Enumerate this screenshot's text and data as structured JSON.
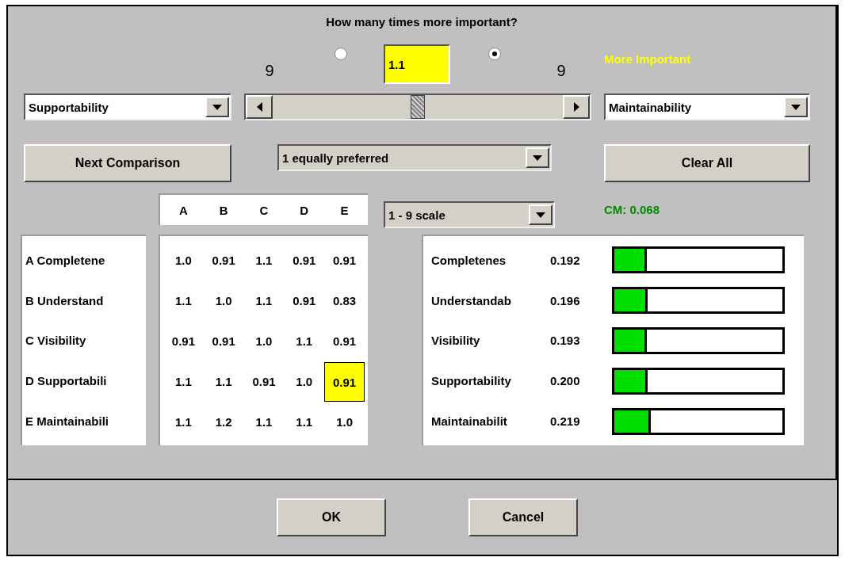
{
  "question": "How many times more important?",
  "radios": [
    {
      "selected": false
    },
    {
      "selected": true
    }
  ],
  "ratio_field": {
    "value": "1.1"
  },
  "scale_labels": [
    "9",
    "9"
  ],
  "more_important_label": "More Important",
  "left_combo": {
    "value": "Supportability"
  },
  "slider": {
    "level": 0.5
  },
  "right_combo": {
    "value": "Maintainability"
  },
  "next_button": "Next Comparison",
  "preference_combo": {
    "value": "1 equally preferred"
  },
  "clear_button": "Clear All",
  "scale_combo": {
    "value": "1 - 9 scale"
  },
  "consistency": "CM: 0.068",
  "matrix": {
    "columns": [
      "A",
      "B",
      "C",
      "D",
      "E"
    ],
    "rows": [
      {
        "label": "A Completene",
        "cells": [
          {
            "text": "1.0",
            "selected": false
          },
          {
            "text": "0.91",
            "selected": false
          },
          {
            "text": "1.1",
            "selected": false
          },
          {
            "text": "0.91",
            "selected": false
          },
          {
            "text": "0.91",
            "selected": false
          }
        ]
      },
      {
        "label": "B Understand",
        "cells": [
          {
            "text": "1.1",
            "selected": false
          },
          {
            "text": "1.0",
            "selected": false
          },
          {
            "text": "1.1",
            "selected": false
          },
          {
            "text": "0.91",
            "selected": false
          },
          {
            "text": "0.83",
            "selected": false
          }
        ]
      },
      {
        "label": "C Visibility",
        "cells": [
          {
            "text": "0.91",
            "selected": false
          },
          {
            "text": "0.91",
            "selected": false
          },
          {
            "text": "1.0",
            "selected": false
          },
          {
            "text": "1.1",
            "selected": false
          },
          {
            "text": "0.91",
            "selected": false
          }
        ]
      },
      {
        "label": "D Supportabili",
        "cells": [
          {
            "text": "1.1",
            "selected": false
          },
          {
            "text": "1.1",
            "selected": false
          },
          {
            "text": "0.91",
            "selected": false
          },
          {
            "text": "1.0",
            "selected": false
          },
          {
            "text": "0.91",
            "selected": true
          }
        ]
      },
      {
        "label": "E Maintainabili",
        "cells": [
          {
            "text": "1.1",
            "selected": false
          },
          {
            "text": "1.2",
            "selected": false
          },
          {
            "text": "1.1",
            "selected": false
          },
          {
            "text": "1.1",
            "selected": false
          },
          {
            "text": "1.0",
            "selected": false
          }
        ]
      }
    ]
  },
  "weights": [
    {
      "name": "Completenes",
      "value": "0.192",
      "level": 0.192
    },
    {
      "name": "Understandab",
      "value": "0.196",
      "level": 0.196
    },
    {
      "name": "Visibility",
      "value": "0.193",
      "level": 0.193
    },
    {
      "name": "Supportability",
      "value": "0.200",
      "level": 0.2
    },
    {
      "name": "Maintainabilit",
      "value": "0.219",
      "level": 0.219
    }
  ],
  "buttons": [
    "OK",
    "Cancel"
  ]
}
